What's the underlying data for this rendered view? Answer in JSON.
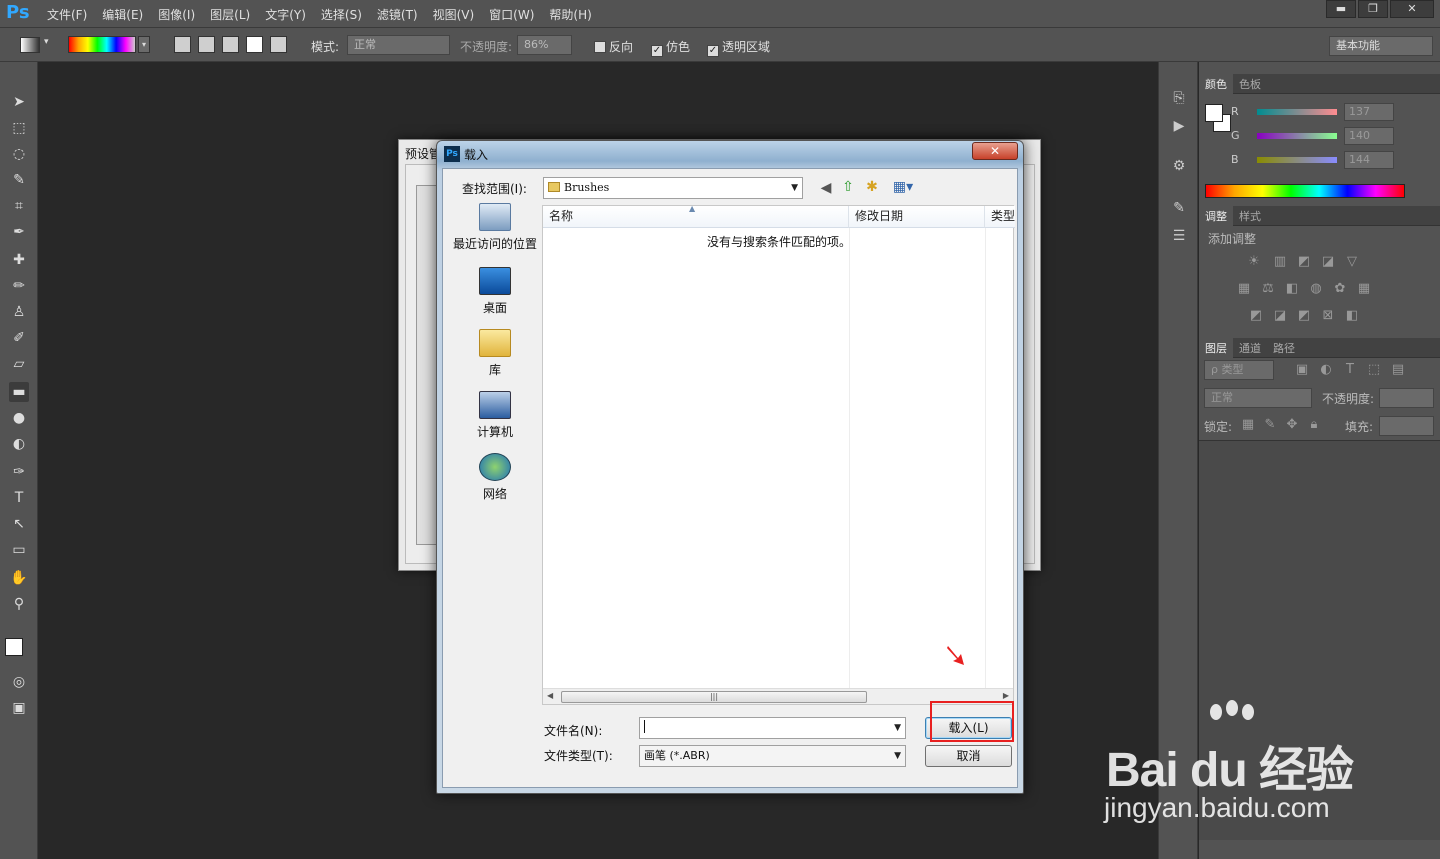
{
  "app": {
    "logo": "Ps",
    "menu": [
      "文件(F)",
      "编辑(E)",
      "图像(I)",
      "图层(L)",
      "文字(Y)",
      "选择(S)",
      "滤镜(T)",
      "视图(V)",
      "窗口(W)",
      "帮助(H)"
    ],
    "window_controls": [
      "▬",
      "❐",
      "✕"
    ]
  },
  "options_bar": {
    "mode_label": "模式:",
    "mode_value": "正常",
    "opacity_label": "不透明度:",
    "opacity_value": "86%",
    "reverse_label": "反向",
    "dither_label": "仿色",
    "transparency_label": "透明区域",
    "workspace": "基本功能"
  },
  "color_panel": {
    "tabs": [
      "颜色",
      "色板"
    ],
    "channels": [
      {
        "label": "R",
        "value": "137"
      },
      {
        "label": "G",
        "value": "140"
      },
      {
        "label": "B",
        "value": "144"
      }
    ]
  },
  "adjust_panel": {
    "tabs": [
      "调整",
      "样式"
    ],
    "title": "添加调整"
  },
  "layers_panel": {
    "tabs": [
      "图层",
      "通道",
      "路径"
    ],
    "filter_label": "ρ 类型",
    "blend_mode": "正常",
    "opacity_label": "不透明度:",
    "lock_label": "锁定:",
    "fill_label": "填充:"
  },
  "preset_dialog": {
    "title": "预设管"
  },
  "load_dialog": {
    "title_icon": "Ps",
    "title": "载入",
    "close_label": "✕",
    "look_in_label": "查找范围(I):",
    "look_in_value": "Brushes",
    "places": [
      "最近访问的位置",
      "桌面",
      "库",
      "计算机",
      "网络"
    ],
    "columns": [
      "名称",
      "修改日期",
      "类型"
    ],
    "empty_message": "没有与搜索条件匹配的项。",
    "filename_label": "文件名(N):",
    "filename_value": "",
    "filetype_label": "文件类型(T):",
    "filetype_value": "画笔 (*.ABR)",
    "load_button": "载入(L)",
    "cancel_button": "取消"
  },
  "watermark": {
    "brand": "Bai du 经验",
    "url": "jingyan.baidu.com"
  },
  "colors": {
    "highlight": "#e82020",
    "ps_blue": "#31a8ff"
  }
}
